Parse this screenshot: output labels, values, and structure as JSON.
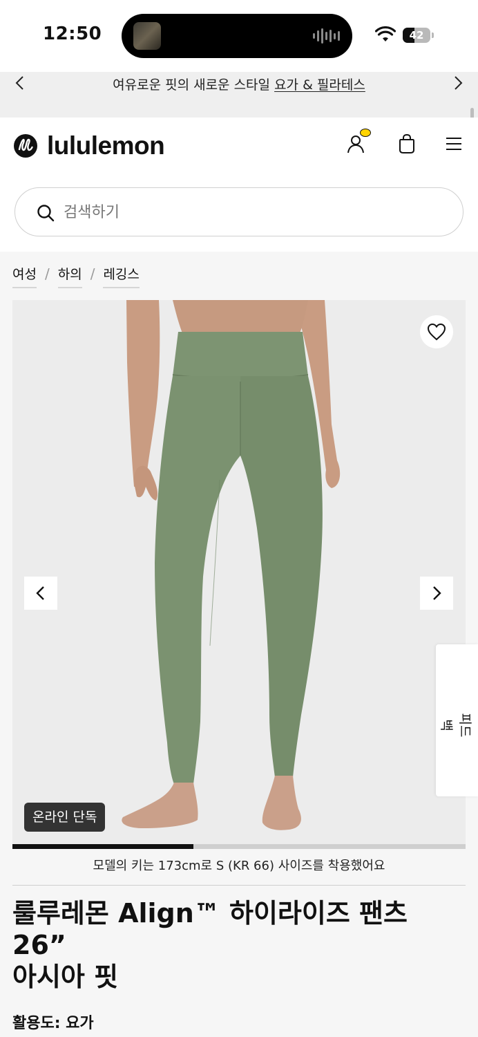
{
  "status_bar": {
    "time": "12:50",
    "battery_level": "42",
    "battery_fraction": 0.42
  },
  "promo": {
    "text": "여유로운 핏의 새로운 스타일",
    "link": "요가 & 필라테스"
  },
  "header": {
    "brand": "lululemon",
    "search_placeholder": "검색하기"
  },
  "breadcrumb": [
    {
      "label": "여성"
    },
    {
      "label": "하의"
    },
    {
      "label": "레깅스"
    }
  ],
  "gallery": {
    "badge": "온라인 단독",
    "progress_fraction": 0.4
  },
  "feedback_tab": {
    "label": "피드백"
  },
  "product": {
    "model_info": "모델의 키는 173cm로 S (KR 66) 사이즈를 착용했어요",
    "title_line1": "룰루레몬 Align™ 하이라이즈 팬츠",
    "title_line2": "26”",
    "title_line3": "아시아 핏",
    "activity": "활용도: 요가"
  },
  "colors": {
    "legging": "#7b9270",
    "background": "#f6f6f6",
    "badge": "#333333",
    "accent_dot": "#ffd400"
  }
}
